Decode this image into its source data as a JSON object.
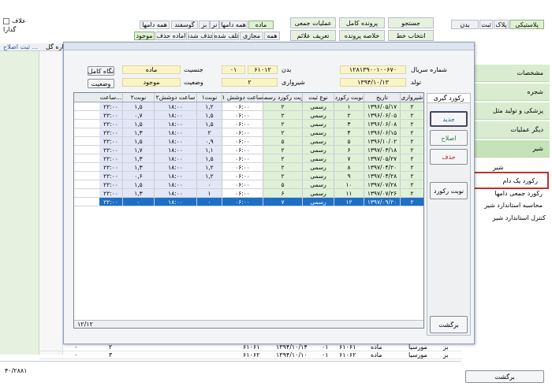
{
  "topleft": {
    "checkbox_label_1": "علاف",
    "checkbox_label_2": "گدارا"
  },
  "top_tabs_row1": [
    "همه دامها",
    "بز",
    "گوسفند",
    "همه دامها",
    "نر",
    "ماده"
  ],
  "top_tabs_row2": [
    "موجود",
    "اماده حذف",
    "حذف شده",
    "تلف شده",
    "مجازی",
    "همه"
  ],
  "menu": {
    "bulk_ops": "عملیات جمعی",
    "full_file": "پرونده کامل",
    "search": "جستجو",
    "define_signs": "تعریف علائم",
    "file_summary": "خلاصه پرونده",
    "choose_line": "انتخاب خط"
  },
  "species_tabs": [
    "پلاستیکی",
    "پلاک",
    "ثبت",
    "بدن"
  ],
  "grid_header_left": "ثبت اصلاح ...",
  "grid_header_mid": "اره گل",
  "dialog": {
    "serial_label": "شماره سریال",
    "serial_value": "۱۲۸۱۳۹۰۰۱۰۰۶۷۰",
    "body_label": "بدن",
    "body_value": "۶۱۰۱۲",
    "body_value2": "۰۱",
    "sex_label": "جنسیت",
    "sex_value": "ماده",
    "birth_label": "تولد",
    "birth_value": "۱۳۹۴/۱۰/۱۳",
    "lact_label": "شیرواری",
    "lact_value": "۲",
    "status_label": "وضعیت",
    "status_value": "موجود",
    "btn_full": "نگاه کامل",
    "btn_status": "وضعیت",
    "record_tab": "رکورد گیری",
    "btn_new": "جدید",
    "btn_edit": "اصلاح",
    "btn_delete": "حذف",
    "btn_record_type": "نوبت رکورد",
    "btn_back": "برگشت",
    "row_count": "۱۲/۱۲"
  },
  "table": {
    "columns": [
      "شیرواری",
      "تاریخ",
      "نوبت رکورد",
      "نوع ثبت",
      "نوبت رکورد رسمی",
      "ساعت دوشش ۱",
      "نوبت۱",
      "ساعت دوشش۲",
      "نوبت۲",
      "ساعت..."
    ],
    "rows": [
      [
        "۲",
        "۱۳۹۶/۰۵/۱۷",
        "۱",
        "رسمی",
        "۲",
        "۰۶:۰۰",
        "۱,۲",
        "۱۸:۰۰",
        "۱,۵",
        "۲۲:۰۰"
      ],
      [
        "۲",
        "۱۳۹۶/۰۶/۰۵",
        "۲",
        "رسمی",
        "۲",
        "۰۶:۰۰",
        "۱,۵",
        "۱۸:۰۰",
        "۰,۷",
        "۲۲:۰۰"
      ],
      [
        "۲",
        "۱۳۹۶/۰۶/۰۸",
        "۳",
        "رسمی",
        "۲",
        "۰۶:۰۰",
        "۱,۵",
        "۱۸:۰۰",
        "۱,۵",
        "۲۲:۰۰"
      ],
      [
        "۲",
        "۱۳۹۶/۰۶/۱۵",
        "۴",
        "رسمی",
        "۲",
        "۰۶:۰۰",
        "۲",
        "۱۸:۰۰",
        "۱,۳",
        "۲۲:۰۰"
      ],
      [
        "۲",
        "۱۳۹۶/۱۰/۰۲",
        "۵",
        "رسمی",
        "۵",
        "۰۶:۰۰",
        "۰,۹",
        "۱۸:۰۰",
        "۱,۵",
        "۲۲:۰۰"
      ],
      [
        "۲",
        "۱۳۹۷/۰۳/۱۸",
        "۶",
        "رسمی",
        "۲",
        "۰۶:۰۰",
        "۱,۱",
        "۱۸:۰۰",
        "۱,۷",
        "۲۲:۰۰"
      ],
      [
        "۲",
        "۱۳۹۷/۰۵/۲۷",
        "۷",
        "رسمی",
        "۲",
        "۰۶:۰۰",
        "۱,۵",
        "۱۸:۰۰",
        "۱,۳",
        "۲۲:۰۰"
      ],
      [
        "۲",
        "۱۳۹۷/۰۴/۲۰",
        "۸",
        "رسمی",
        "۲",
        "۰۶:۰۰",
        "۱,۲",
        "۱۸:۰۰",
        "۱,۳",
        "۲۲:۰۰"
      ],
      [
        "۲",
        "۱۳۹۷/۰۴/۲۸",
        "۹",
        "رسمی",
        "۲",
        "۰۶:۰۰",
        "۱,۲",
        "۱۸:۰۰",
        "۰,۶",
        "۲۲:۰۰"
      ],
      [
        "۲",
        "۱۳۹۷/۰۷/۲۸",
        "۱۰",
        "رسمی",
        "۵",
        "۰۶:۰۰",
        "۰",
        "۱۸:۰۰",
        "۱,۵",
        "۲۲:۰۰"
      ],
      [
        "۲",
        "۱۳۹۷/۰۷/۲۶",
        "۱۱",
        "رسمی",
        "۶",
        "۰۶:۰۰",
        "۱",
        "۱۸:۰۰",
        "۱,۳",
        "۲۲:۰۰"
      ],
      [
        "۲",
        "۱۳۹۷/۰۹/۲۰",
        "۱۲",
        "رسمی",
        "۷",
        "۰۶:۰۰",
        "۰",
        "۱۸:۰۰",
        "۰",
        "۲۲:۰۰"
      ]
    ],
    "selected_row_index": 11
  },
  "right_panel": {
    "items": [
      "مشخصات",
      "شجره",
      "پزشکی و تولید مثل",
      "دیگر عملیات",
      "شیر"
    ],
    "sub_items": [
      "شیر",
      "رکورد یک دام",
      "رکورد جمعی دامها",
      "محاسبه استاندارد شیر",
      "کنترل استاندارد شیر"
    ],
    "back": "برگشت"
  },
  "bottom_rows": [
    [
      "بز",
      "مورسیا",
      "ماده",
      "۶۱۰۶۱",
      "۰۱",
      "۱۳۹۴/۱۰/۱۴",
      "۶۱۰۶۱",
      "۲",
      "۰"
    ],
    [
      "بز",
      "مورسیا",
      "ماده",
      "۶۱۰۶۲",
      "۰۱",
      "۱۳۹۴/۱۰/۱۰",
      "۶۱۰۶۲",
      "۳",
      "۰"
    ]
  ],
  "status_value": "۴۰/۲۸۸۱"
}
